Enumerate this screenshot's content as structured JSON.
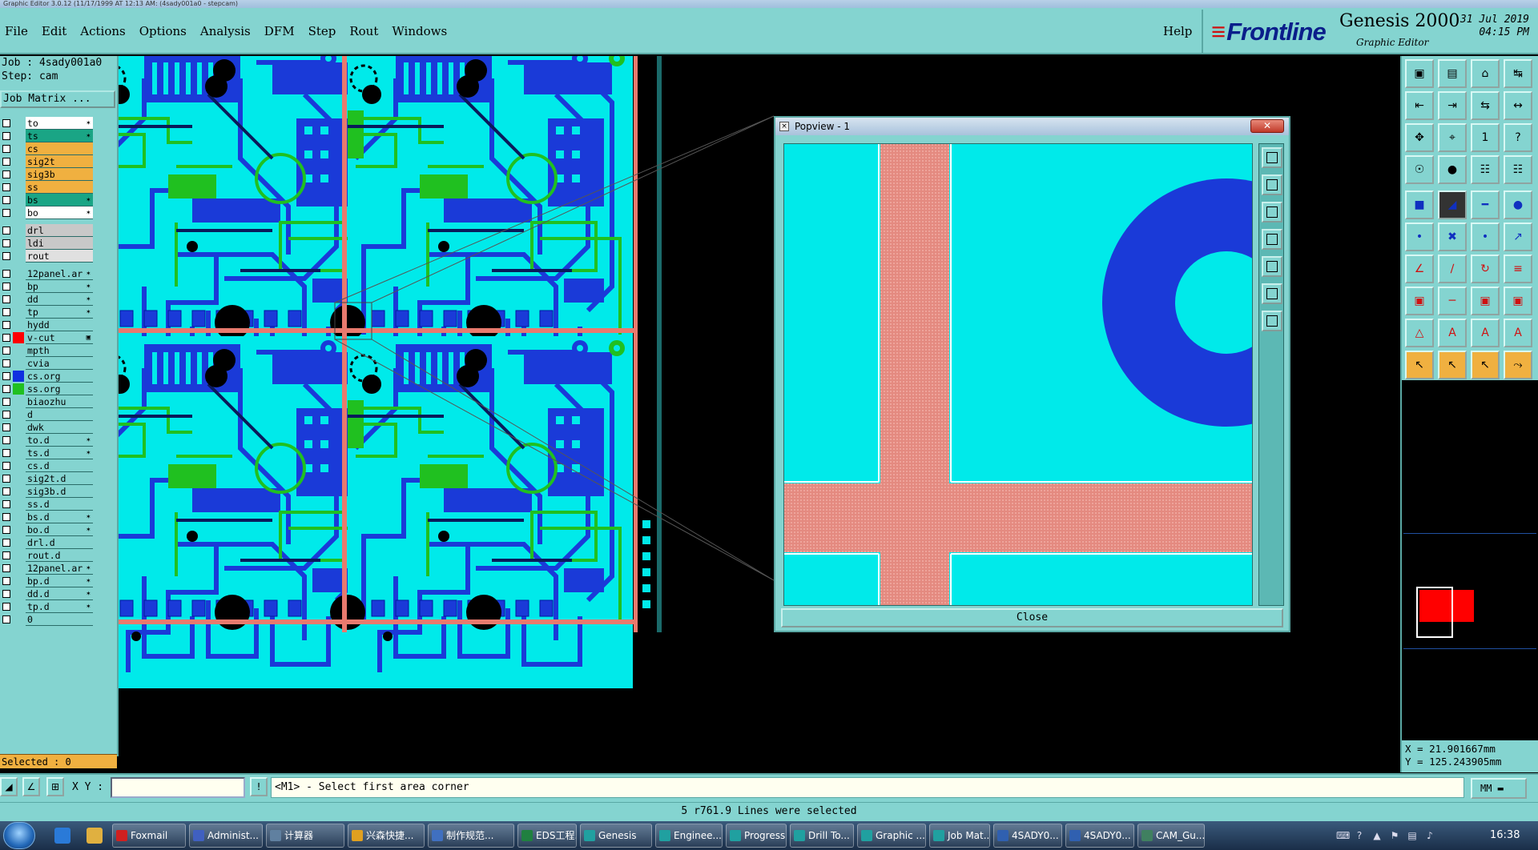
{
  "window": {
    "title": "Graphic Editor 3.0.12 (11/17/1999 AT 12:13 AM: (4sady001a0 - stepcam)"
  },
  "menu": {
    "items": [
      "File",
      "Edit",
      "Actions",
      "Options",
      "Analysis",
      "DFM",
      "Step",
      "Rout",
      "Windows"
    ],
    "help": "Help"
  },
  "brand": {
    "logo": "Frontline",
    "product": "Genesis 2000",
    "subtitle": "Graphic Editor",
    "date": "31 Jul 2019",
    "time": "04:15 PM"
  },
  "job": {
    "job_line": "Job : 4sady001a0",
    "step_line": "Step: cam",
    "matrix_button": "Job Matrix ..."
  },
  "layers": [
    {
      "name": "to",
      "bg": "#ffffff",
      "mark": "✶"
    },
    {
      "name": "ts",
      "bg": "#1aa585",
      "mark": "✶"
    },
    {
      "name": "cs",
      "bg": "#f0b040",
      "mark": ""
    },
    {
      "name": "sig2t",
      "bg": "#f0b040",
      "mark": ""
    },
    {
      "name": "sig3b",
      "bg": "#f0b040",
      "mark": ""
    },
    {
      "name": "ss",
      "bg": "#f0b040",
      "mark": ""
    },
    {
      "name": "bs",
      "bg": "#1aa585",
      "mark": "✶"
    },
    {
      "name": "bo",
      "bg": "#ffffff",
      "mark": "✶"
    },
    {
      "gap": true
    },
    {
      "name": "drl",
      "bg": "#c8c8c8",
      "mark": ""
    },
    {
      "name": "ldi",
      "bg": "#c8c8c8",
      "mark": ""
    },
    {
      "name": "rout",
      "bg": "#e0e0e0",
      "mark": ""
    },
    {
      "gap": true
    },
    {
      "name": "12panel.ar",
      "bg": "#84d4d0",
      "mark": "✶"
    },
    {
      "name": "bp",
      "bg": "#84d4d0",
      "mark": "✶"
    },
    {
      "name": "dd",
      "bg": "#84d4d0",
      "mark": "✶"
    },
    {
      "name": "tp",
      "bg": "#84d4d0",
      "mark": "✶"
    },
    {
      "name": "hydd",
      "bg": "#84d4d0",
      "mark": ""
    },
    {
      "name": "v-cut",
      "bg": "#84d4d0",
      "mark": "▣",
      "swatch": "#ff0000"
    },
    {
      "name": "mpth",
      "bg": "#84d4d0",
      "mark": ""
    },
    {
      "name": "cvia",
      "bg": "#84d4d0",
      "mark": ""
    },
    {
      "name": "cs.org",
      "bg": "#84d4d0",
      "mark": "",
      "swatch": "#1030e0"
    },
    {
      "name": "ss.org",
      "bg": "#84d4d0",
      "mark": "",
      "swatch": "#20c020"
    },
    {
      "name": "biaozhu",
      "bg": "#84d4d0",
      "mark": ""
    },
    {
      "name": "d",
      "bg": "#84d4d0",
      "mark": ""
    },
    {
      "name": "dwk",
      "bg": "#84d4d0",
      "mark": ""
    },
    {
      "name": "to.d",
      "bg": "#84d4d0",
      "mark": "✶"
    },
    {
      "name": "ts.d",
      "bg": "#84d4d0",
      "mark": "✶"
    },
    {
      "name": "cs.d",
      "bg": "#84d4d0",
      "mark": ""
    },
    {
      "name": "sig2t.d",
      "bg": "#84d4d0",
      "mark": ""
    },
    {
      "name": "sig3b.d",
      "bg": "#84d4d0",
      "mark": ""
    },
    {
      "name": "ss.d",
      "bg": "#84d4d0",
      "mark": ""
    },
    {
      "name": "bs.d",
      "bg": "#84d4d0",
      "mark": "✶"
    },
    {
      "name": "bo.d",
      "bg": "#84d4d0",
      "mark": "✶"
    },
    {
      "name": "drl.d",
      "bg": "#84d4d0",
      "mark": ""
    },
    {
      "name": "rout.d",
      "bg": "#84d4d0",
      "mark": ""
    },
    {
      "name": "12panel.ar",
      "bg": "#84d4d0",
      "mark": "✶"
    },
    {
      "name": "bp.d",
      "bg": "#84d4d0",
      "mark": "✶"
    },
    {
      "name": "dd.d",
      "bg": "#84d4d0",
      "mark": "✶"
    },
    {
      "name": "tp.d",
      "bg": "#84d4d0",
      "mark": "✶"
    },
    {
      "name": "0",
      "bg": "#84d4d0",
      "mark": ""
    }
  ],
  "selected": "Selected : 0",
  "popview": {
    "title": "Popview - 1",
    "close_x": "✕",
    "close_button": "Close"
  },
  "coords": {
    "x": "X = 21.901667mm",
    "y": "Y = 125.243905mm"
  },
  "command": {
    "xy_label": "X Y :",
    "xy_value": "",
    "prompt": "<M1> - Select first area corner",
    "units": "MM"
  },
  "status": "5 r761.9 Lines were selected",
  "taskbar": {
    "tasks": [
      {
        "label": "Foxmail",
        "color": "#d02020"
      },
      {
        "label": "Administ...",
        "color": "#4060c0"
      },
      {
        "label": "计算器",
        "color": "#6080a0"
      },
      {
        "label": "兴森快捷...",
        "color": "#e0a020"
      },
      {
        "label": "制作规范...",
        "color": "#4070c0"
      },
      {
        "label": "EDS工程...",
        "color": "#208040"
      },
      {
        "label": "Genesis",
        "color": "#20a0a0"
      },
      {
        "label": "Enginee...",
        "color": "#20a0a0"
      },
      {
        "label": "Progress",
        "color": "#20a0a0"
      },
      {
        "label": "Drill To...",
        "color": "#20a0a0"
      },
      {
        "label": "Graphic ...",
        "color": "#20a0a0"
      },
      {
        "label": "Job Mat...",
        "color": "#20a0a0"
      },
      {
        "label": "4SADY0...",
        "color": "#3060b0"
      },
      {
        "label": "4SADY0...",
        "color": "#3060b0"
      },
      {
        "label": "CAM_Gu...",
        "color": "#408060"
      }
    ],
    "clock": "16:38"
  }
}
